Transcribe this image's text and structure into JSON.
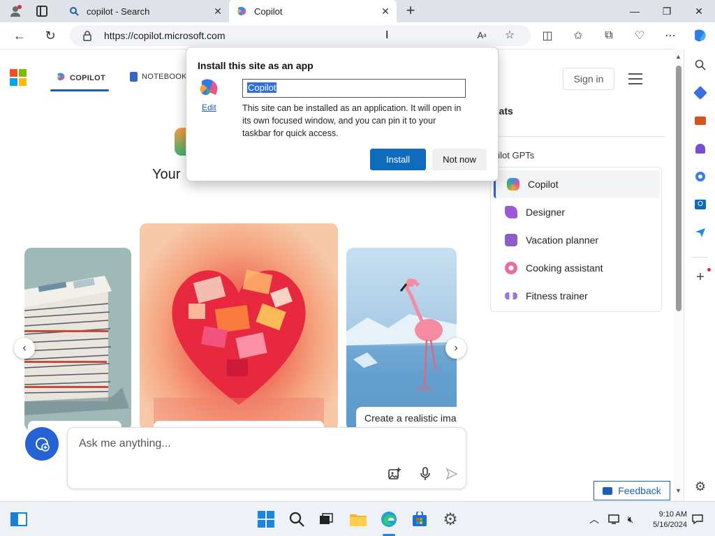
{
  "browser": {
    "tabs": [
      {
        "title": "copilot - Search",
        "icon": "search-icon",
        "active": false
      },
      {
        "title": "Copilot",
        "icon": "copilot-icon",
        "active": true
      }
    ],
    "address": {
      "url": "https://copilot.microsoft.com"
    }
  },
  "page": {
    "nav": {
      "copilot_tab": "COPILOT",
      "notebook_tab": "NOTEBOOK"
    },
    "sign_in": "Sign in",
    "hero_text": "Your",
    "carousel": {
      "caption": "Create a realistic ima"
    },
    "chat": {
      "placeholder": "Ask me anything..."
    },
    "right_panel": {
      "chats_heading": "hats",
      "gpts_heading": "pilot GPTs",
      "gpts": [
        {
          "name": "Copilot",
          "color": "#6b5cf0",
          "selected": true
        },
        {
          "name": "Designer",
          "color": "#9b59d6",
          "selected": false
        },
        {
          "name": "Vacation planner",
          "color": "#8e5cc9",
          "selected": false
        },
        {
          "name": "Cooking assistant",
          "color": "#e86aa0",
          "selected": false
        },
        {
          "name": "Fitness trainer",
          "color": "#9c7bd6",
          "selected": false
        }
      ]
    },
    "feedback": "Feedback"
  },
  "popup": {
    "title": "Install this site as an app",
    "edit": "Edit",
    "app_name_value": "Copilot",
    "description": "This site can be installed as an application. It will open in its own focused window, and you can pin it to your taskbar for quick access.",
    "install_button": "Install",
    "not_now_button": "Not now"
  },
  "taskbar": {
    "time": "9:10 AM",
    "date": "5/16/2024"
  },
  "colors": {
    "accent": "#0f6cbd",
    "link": "#1a5fb4",
    "tabbar": "#dfe3e8"
  }
}
